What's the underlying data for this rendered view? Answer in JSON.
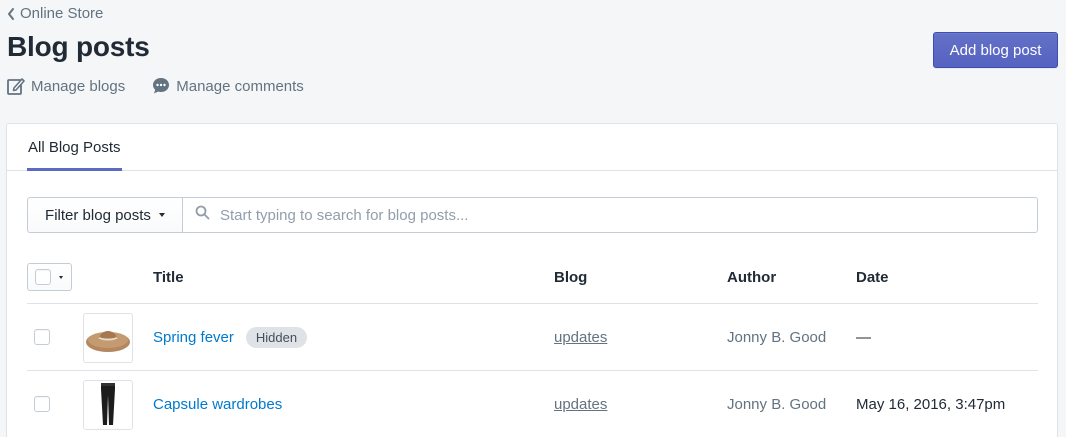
{
  "breadcrumb": {
    "label": "Online Store"
  },
  "page": {
    "title": "Blog posts"
  },
  "primary_action": {
    "label": "Add blog post"
  },
  "secondary_actions": [
    {
      "label": "Manage blogs",
      "icon": "edit-icon"
    },
    {
      "label": "Manage comments",
      "icon": "comment-icon"
    }
  ],
  "tabs": [
    {
      "label": "All Blog Posts",
      "selected": true
    }
  ],
  "filter": {
    "label": "Filter blog posts",
    "placeholder": "Start typing to search for blog posts..."
  },
  "table": {
    "headers": {
      "title": "Title",
      "blog": "Blog",
      "author": "Author",
      "date": "Date"
    },
    "rows": [
      {
        "thumbnail": "hat-image",
        "title": "Spring fever",
        "badge": "Hidden",
        "blog": "updates",
        "author": "Jonny B. Good",
        "date": "—"
      },
      {
        "thumbnail": "pants-image",
        "title": "Capsule wardrobes",
        "badge": "",
        "blog": "updates",
        "author": "Jonny B. Good",
        "date": "May 16, 2016, 3:47pm"
      }
    ]
  },
  "colors": {
    "primary": "#5c6ac4",
    "link": "#007ace",
    "subdued": "#637381",
    "border": "#dfe3e8"
  }
}
